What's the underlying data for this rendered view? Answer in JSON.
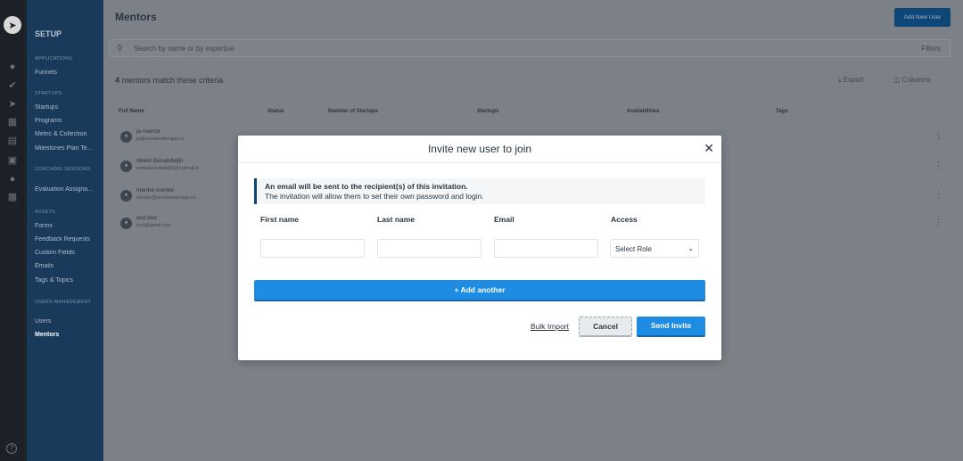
{
  "rail": {
    "logo_icon": "rocket-icon",
    "icons": [
      "user-icon",
      "check-circle-icon",
      "rocket-icon",
      "grid-icon",
      "document-icon",
      "calendar-icon",
      "people-icon",
      "form-icon"
    ],
    "help_icon": "help-icon"
  },
  "sidebar": {
    "title": "SETUP",
    "sections": [
      {
        "label": "APPLICATIONS",
        "items": [
          "Funnels"
        ]
      },
      {
        "label": "STARTUPS",
        "items": [
          "Startups",
          "Programs",
          "Metric & Collection",
          "Milestones Plan Te..."
        ]
      },
      {
        "label": "COACHING SESSIONS",
        "items": [
          "Evaluation Assigna..."
        ]
      },
      {
        "label": "ASSETS",
        "items": [
          "Forms",
          "Feedback Requests",
          "Custom Fields",
          "Emails",
          "Tags & Topics"
        ]
      },
      {
        "label": "USERS MANAGEMENT",
        "items": [
          "Users",
          "Mentors"
        ]
      }
    ],
    "active_item": "Mentors"
  },
  "main": {
    "title": "Mentors",
    "add_user_label": "Add New User",
    "search_placeholder": "Search by name or by expertise",
    "filters_label": "Filters",
    "match_count": "4",
    "match_text": "mentors match these criteria",
    "export_label": "Export",
    "columns_label": "Columns",
    "table_headers": [
      "Full Name",
      "Status",
      "Number of Startups",
      "Startups",
      "Availabilities",
      "Tags"
    ],
    "rows": [
      {
        "name": "ja mentor",
        "email": "ja@acceleratorapp.co"
      },
      {
        "name": "Mekki Benabdeljlil",
        "email": "mekkibenabdeljlil@hotmail.fr"
      },
      {
        "name": "mentor mentor",
        "email": "mentor@acceleratorapp.co"
      },
      {
        "name": "test test",
        "email": "test@gmail.com"
      }
    ]
  },
  "modal": {
    "title": "Invite new user to join",
    "close_icon": "close-icon",
    "info_line1": "An email will be sent to the recipient(s) of this invitation.",
    "info_line2": "The invitation will allow them to set their own password and login.",
    "first_name_label": "First name",
    "last_name_label": "Last name",
    "email_label": "Email",
    "access_label": "Access",
    "first_name_value": "",
    "last_name_value": "",
    "email_value": "",
    "access_value": "Select Role",
    "add_another_label": "+ Add another",
    "bulk_import_label": "Bulk Import",
    "cancel_label": "Cancel",
    "send_label": "Send Invite"
  },
  "colors": {
    "sidebar_bg": "#1a3a5c",
    "rail_bg": "#1b2126",
    "primary": "#1f8ce3",
    "dark_accent": "#0d4677"
  }
}
